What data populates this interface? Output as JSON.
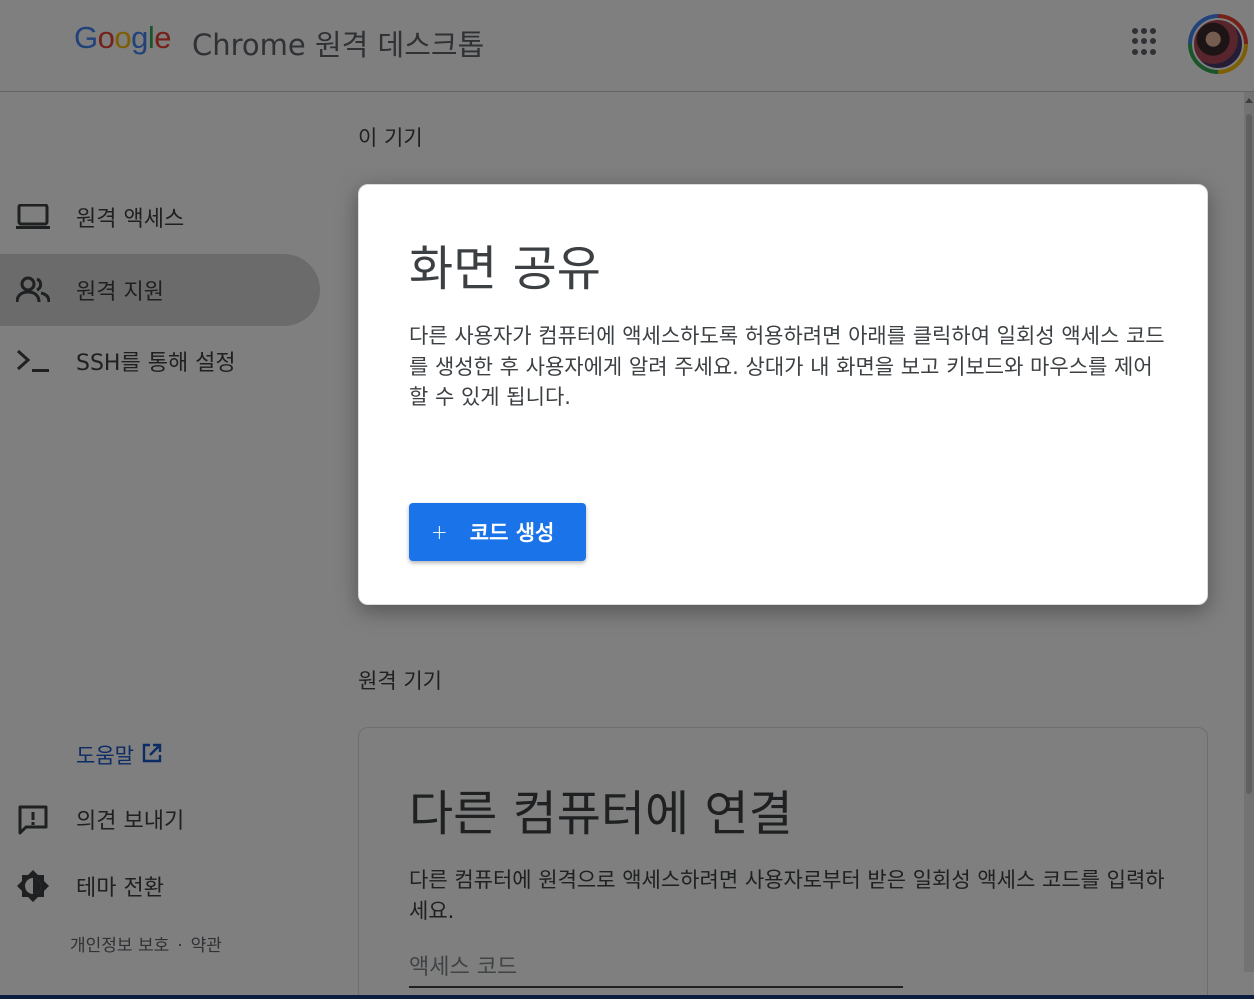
{
  "header": {
    "logo": [
      "G",
      "o",
      "o",
      "g",
      "l",
      "e"
    ],
    "product": "Chrome 원격 데스크톱",
    "apps_icon": "apps-grid-icon",
    "avatar": "account-avatar"
  },
  "sidebar": {
    "items": [
      {
        "label": "원격 액세스",
        "icon": "laptop-icon",
        "active": false
      },
      {
        "label": "원격 지원",
        "icon": "people-icon",
        "active": true
      },
      {
        "label": "SSH를 통해 설정",
        "icon": "terminal-icon",
        "active": false
      }
    ],
    "help": "도움말",
    "feedback": "의견 보내기",
    "theme": "테마 전환",
    "privacy": "개인정보 보호",
    "separator": "·",
    "terms": "약관"
  },
  "main": {
    "this_device_title": "이 기기",
    "share": {
      "title": "화면 공유",
      "description": "다른 사용자가 컴퓨터에 액세스하도록 허용하려면 아래를 클릭하여 일회성 액세스 코드를 생성한 후 사용자에게 알려 주세요. 상대가 내 화면을 보고 키보드와 마우스를 제어할 수 있게 됩니다.",
      "button_plus": "+",
      "button_label": "코드 생성"
    },
    "remote_devices_title": "원격 기기",
    "connect": {
      "title": "다른 컴퓨터에 연결",
      "description": "다른 컴퓨터에 원격으로 액세스하려면 사용자로부터 받은 일회성 액세스 코드를 입력하세요.",
      "input_placeholder": "액세스 코드",
      "input_value": ""
    }
  },
  "colors": {
    "accent": "#1a73e8",
    "link": "#1a57c9",
    "scrim": "rgba(0,0,0,0.5)"
  }
}
